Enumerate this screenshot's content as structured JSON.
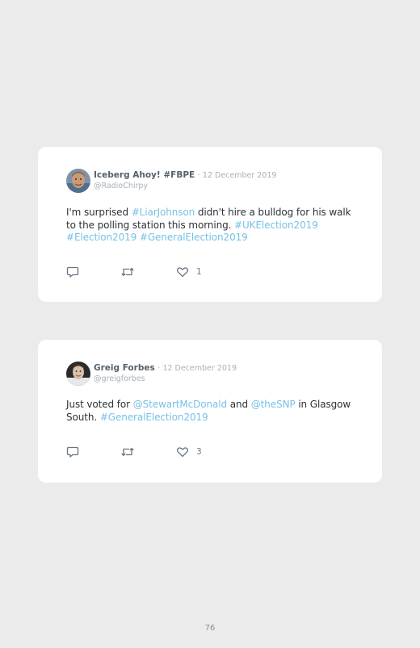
{
  "tweets": [
    {
      "display_name": "Iceberg Ahoy! #FBPE",
      "separator": "·",
      "date": "12 December 2019",
      "handle": "@RadioChirpy",
      "text_parts": [
        "I'm surprised ",
        "#LiarJohnson",
        " didn't hire a bulldog for his walk to the polling station this morning. ",
        "#UKElection2019",
        " ",
        "#Election2019",
        " ",
        "#GeneralElection2019"
      ],
      "like_count": "1"
    },
    {
      "display_name": "Greig Forbes",
      "separator": "·",
      "date": "12 December 2019",
      "handle": "@greigforbes",
      "text_parts": [
        "Just voted for ",
        "@StewartMcDonald",
        " and ",
        "@theSNP",
        " in Glasgow South. ",
        "#GeneralElection2019"
      ],
      "like_count": "3"
    }
  ],
  "icons": {
    "reply": "reply-icon",
    "retweet": "retweet-icon",
    "like": "heart-icon"
  },
  "colors": {
    "page_background": "#ebebeb",
    "card_background": "#ffffff",
    "link": "#76c1e6",
    "name": "#56606c",
    "meta": "#a8b0b8"
  },
  "footer": {
    "page_number": "76"
  }
}
